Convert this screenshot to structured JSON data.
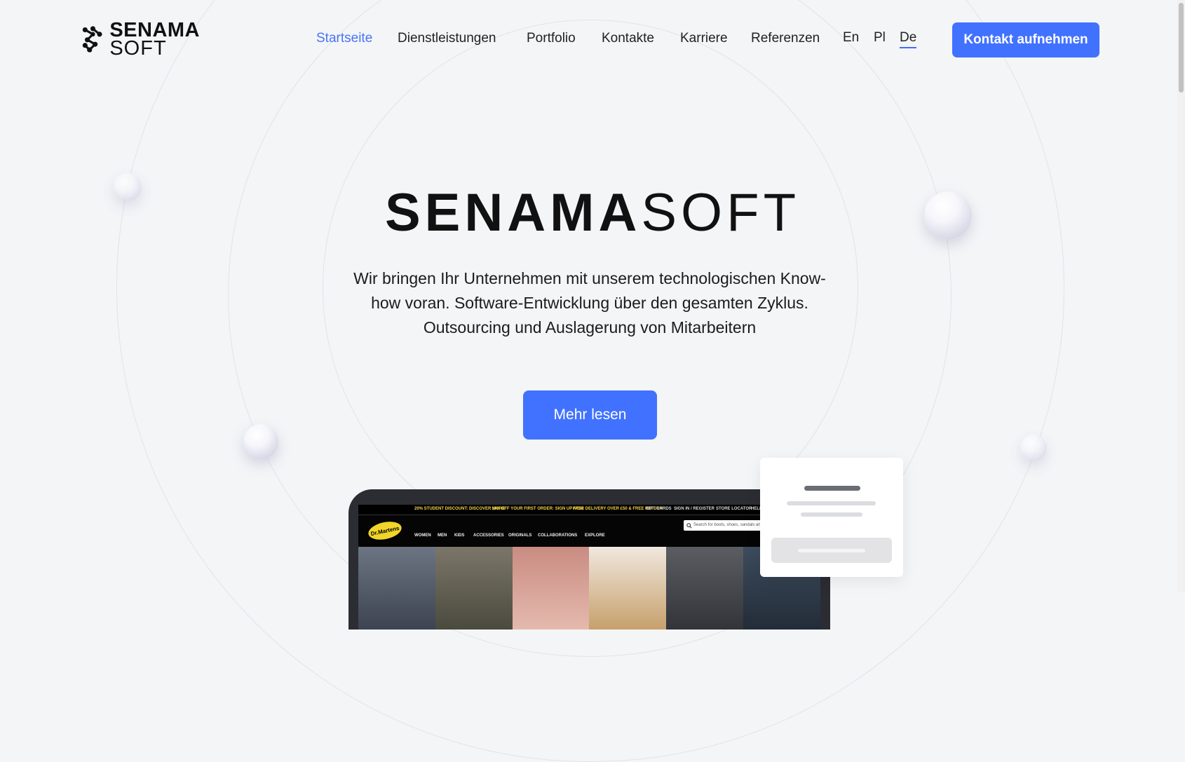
{
  "header": {
    "logo": {
      "name_bold": "SENAMA",
      "name_light": "SOFT"
    },
    "nav": [
      {
        "label": "Startseite",
        "active": true
      },
      {
        "label": "Dienstleistungen"
      },
      {
        "label": "Portfolio"
      },
      {
        "label": "Kontakte"
      },
      {
        "label": "Karriere"
      },
      {
        "label": "Referenzen"
      }
    ],
    "languages": [
      "En",
      "Pl",
      "De"
    ],
    "current_language": "De",
    "cta_label": "Kontakt aufnehmen"
  },
  "hero": {
    "title_bold": "SENAMA",
    "title_light": "SOFT",
    "description": "Wir bringen Ihr Unternehmen mit unserem technologischen Know-how voran. Software-Entwicklung über den gesamten Zyklus. Outsourcing und Auslagerung von Mitarbeitern",
    "button_label": "Mehr lesen"
  },
  "laptop_preview": {
    "promo_items": [
      "20% STUDENT DISCOUNT: DISCOVER MORE",
      "10% OFF YOUR FIRST ORDER: SIGN UP NOW",
      "FREE DELIVERY OVER £50 & FREE RETURN",
      "GIFT CARDS",
      "SIGN IN / REGISTER",
      "STORE LOCATOR",
      "HELP"
    ],
    "brand": "Dr.Martens",
    "menu": [
      "WOMEN",
      "MEN",
      "KIDS",
      "ACCESSORIES",
      "ORIGINALS",
      "COLLABORATIONS",
      "EXPLORE"
    ],
    "search_placeholder": "Search for boots, shoes, sandals and more"
  },
  "colors": {
    "accent": "#4171ff",
    "active_link": "#4a74f5",
    "background": "#f3f5f7"
  }
}
